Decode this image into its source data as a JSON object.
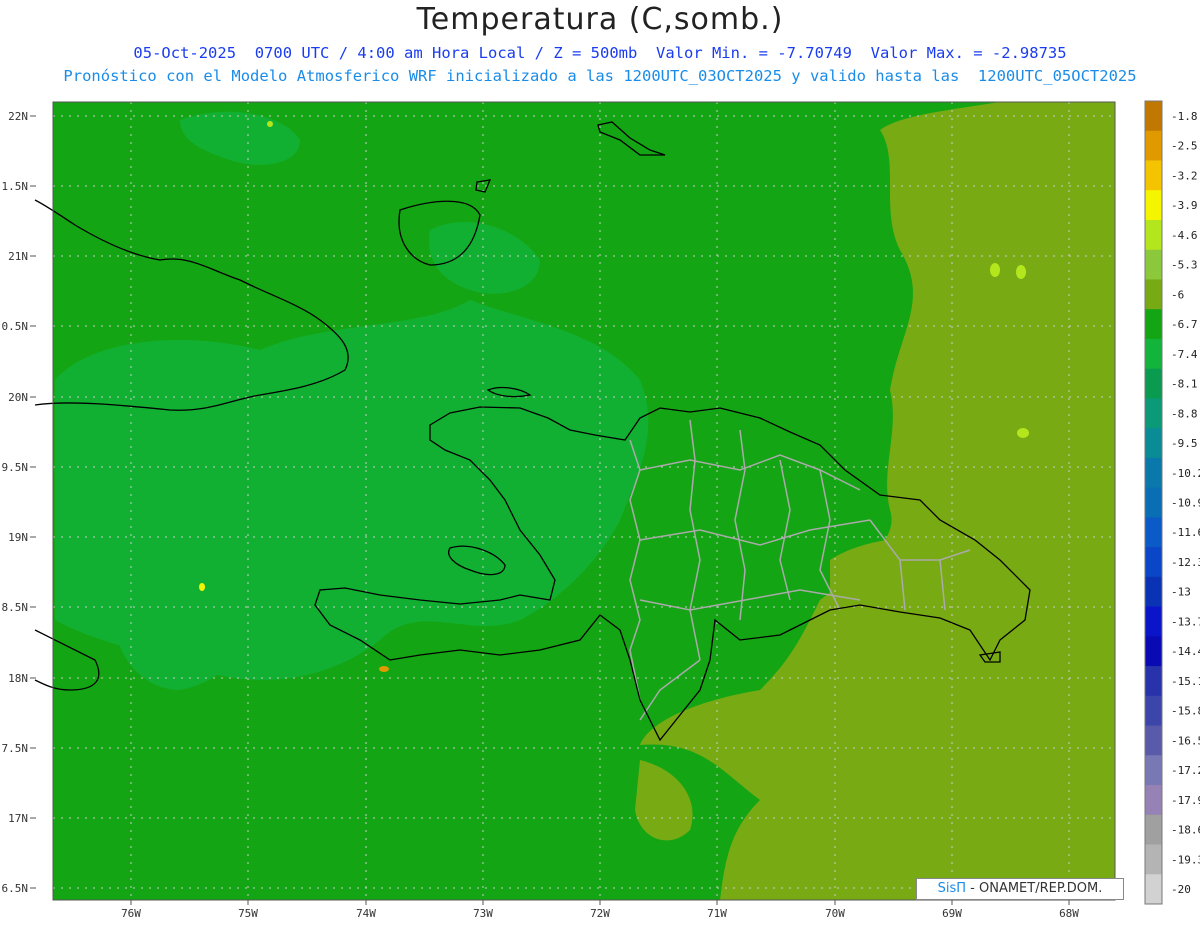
{
  "header": {
    "title": "Temperatura (C,somb.)",
    "line1": "05-Oct-2025  0700 UTC / 4:00 am Hora Local / Z = 500mb  Valor Min. = -7.70749  Valor Max. = -2.98735",
    "line2": "Pronóstico con el Modelo Atmosferico WRF inicializado a las 1200UTC_03OCT2025 y valido hasta las  1200UTC_05OCT2025"
  },
  "axes": {
    "lat_labels": [
      "22N",
      "1.5N",
      "21N",
      "0.5N",
      "20N",
      "9.5N",
      "19N",
      "8.5N",
      "18N",
      "7.5N",
      "17N",
      "6.5N"
    ],
    "lon_labels": [
      "76W",
      "75W",
      "74W",
      "73W",
      "72W",
      "71W",
      "70W",
      "69W",
      "68W"
    ]
  },
  "legend": {
    "labels": [
      "-1.8",
      "-2.5",
      "-3.2",
      "-3.9",
      "-4.6",
      "-5.3",
      "-6",
      "-6.7",
      "-7.4",
      "-8.1",
      "-8.8",
      "-9.5",
      "-10.2",
      "-10.9",
      "-11.6",
      "-12.3",
      "-13",
      "-13.7",
      "-14.4",
      "-15.1",
      "-15.8",
      "-16.5",
      "-17.2",
      "-17.9",
      "-18.6",
      "-19.3",
      "-20"
    ],
    "colors": [
      "#c07800",
      "#e09a00",
      "#f5c400",
      "#f5f500",
      "#b4e61e",
      "#8cc83c",
      "#78aa14",
      "#14a514",
      "#12b43c",
      "#0a9a50",
      "#0a9a78",
      "#0a8c96",
      "#0a78aa",
      "#0a6eb4",
      "#0a5ac8",
      "#0a46c8",
      "#0a32b4",
      "#0a14c8",
      "#0a0ab4",
      "#2832aa",
      "#3c46aa",
      "#5a5aaa",
      "#7878b4",
      "#9682b4",
      "#a0a0a0",
      "#b4b4b4",
      "#d2d2d2"
    ]
  },
  "credit": {
    "logo": "SisΠ",
    "text": " - ONAMET/REP.DOM."
  },
  "colors": {
    "field_main": "#14a514",
    "field_warm": "#78aa14",
    "field_cool": "#12b43c",
    "coast": "#000000",
    "provinces": "#aaaaaa",
    "grid": "#cccccc"
  }
}
